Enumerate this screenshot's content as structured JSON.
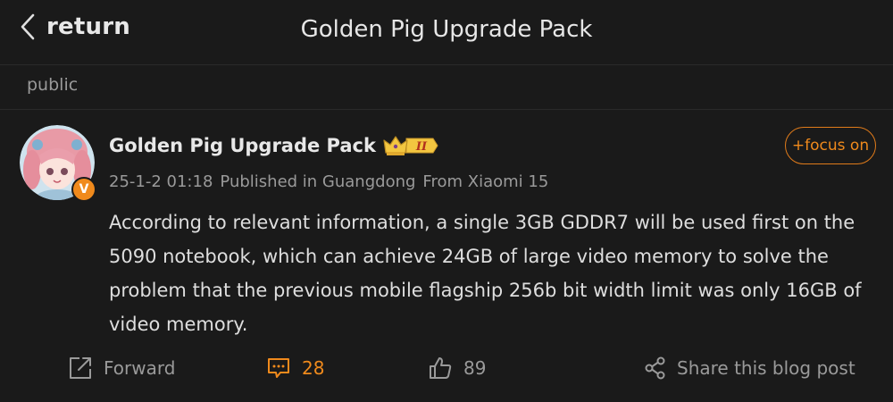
{
  "header": {
    "back_label": "return",
    "title": "Golden Pig Upgrade Pack"
  },
  "section": {
    "label": "public"
  },
  "post": {
    "author_name": "Golden Pig Upgrade Pack",
    "verified_mark": "V",
    "rank_badge": "II",
    "follow_label": "+focus on",
    "timestamp": "25-1-2 01:18",
    "location": "Published in Guangdong",
    "device": "From Xiaomi 15",
    "content": "According to relevant information, a single 3GB GDDR7 will be used first on the 5090 notebook, which can achieve 24GB of large video memory to solve the problem that the previous mobile flagship 256b bit width limit was only 16GB of video memory."
  },
  "actions": {
    "forward_label": "Forward",
    "comment_count": "28",
    "like_count": "89",
    "share_label": "Share this blog post"
  },
  "colors": {
    "background": "#1a1a1a",
    "accent": "#f08a1c",
    "text_primary": "#e6e6e6",
    "text_secondary": "#9a9a9a"
  }
}
